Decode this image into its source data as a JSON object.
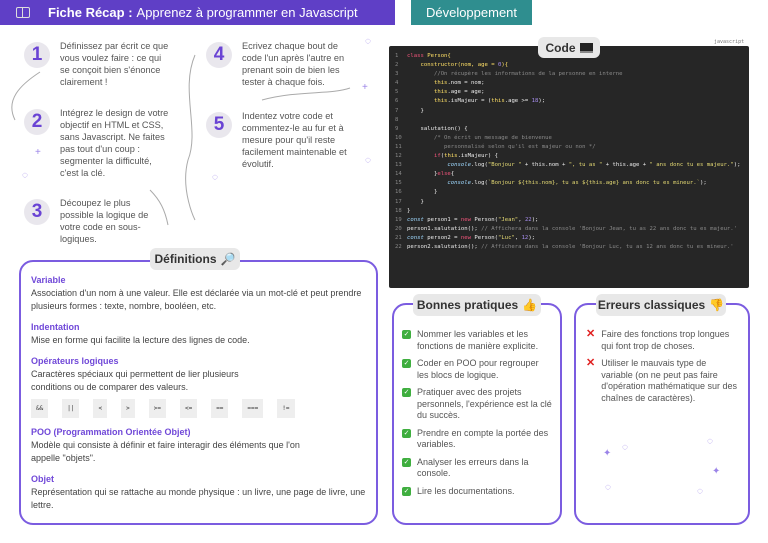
{
  "header": {
    "title_bold": "Fiche Récap :",
    "title": "Apprenez à programmer en Javascript",
    "tag": "Développement",
    "icon": "book-icon"
  },
  "steps": [
    {
      "num": "1",
      "text": "Définissez par écrit ce que vous voulez faire : ce qui se conçoit bien s'énonce clairement !"
    },
    {
      "num": "2",
      "text": "Intégrez le design de votre objectif en HTML et CSS, sans Javascript. Ne faites pas tout d'un coup : segmenter la difficulté, c'est la clé."
    },
    {
      "num": "3",
      "text": "Découpez le plus possible la logique de votre code en sous-logiques."
    },
    {
      "num": "4",
      "text": "Ecrivez chaque bout de code l'un après l'autre en prenant soin de bien les tester à chaque fois."
    },
    {
      "num": "5",
      "text": "Indentez votre code et commentez-le au fur et à mesure pour qu'il reste facilement maintenable et évolutif."
    }
  ],
  "code": {
    "label": "Code",
    "language": "javascript",
    "icon": "laptop-icon",
    "lines": [
      {
        "n": "1",
        "t": [
          [
            "class ",
            "k"
          ],
          [
            "Person{",
            "f"
          ]
        ]
      },
      {
        "n": "2",
        "t": [
          [
            "    constructor(nom, age = ",
            "f"
          ],
          [
            "0",
            "n"
          ],
          [
            "){",
            "f"
          ]
        ]
      },
      {
        "n": "3",
        "t": [
          [
            "        //On récupère les informations de la personne en interne",
            "c"
          ]
        ]
      },
      {
        "n": "4",
        "t": [
          [
            "        this",
            "f"
          ],
          [
            ".nom = nom;",
            ""
          ]
        ]
      },
      {
        "n": "5",
        "t": [
          [
            "        this",
            "f"
          ],
          [
            ".age = age;",
            ""
          ]
        ]
      },
      {
        "n": "6",
        "t": [
          [
            "        this",
            "f"
          ],
          [
            ".isMajeur = (",
            ""
          ],
          [
            "this",
            "f"
          ],
          [
            ".age >= ",
            ""
          ],
          [
            "18",
            "n"
          ],
          [
            ");",
            ""
          ]
        ]
      },
      {
        "n": "7",
        "t": [
          [
            "    }",
            ""
          ]
        ]
      },
      {
        "n": "8",
        "t": [
          [
            "",
            ""
          ]
        ]
      },
      {
        "n": "9",
        "t": [
          [
            "    salutation() {",
            ""
          ]
        ]
      },
      {
        "n": "10",
        "t": [
          [
            "        /* On écrit un message de bienvenue",
            "c"
          ]
        ]
      },
      {
        "n": "11",
        "t": [
          [
            "           personnalisé selon qu'il est majeur ou non */",
            "c"
          ]
        ]
      },
      {
        "n": "12",
        "t": [
          [
            "        if",
            "k"
          ],
          [
            "(",
            ""
          ],
          [
            "this",
            "f"
          ],
          [
            ".isMajeur) {",
            ""
          ]
        ]
      },
      {
        "n": "13",
        "t": [
          [
            "            console",
            "i"
          ],
          [
            ".log(",
            ""
          ],
          [
            "\"Bonjour \"",
            "s"
          ],
          [
            " + this.nom + ",
            ""
          ],
          [
            "\", tu as \"",
            "s"
          ],
          [
            " + this.age + ",
            ""
          ],
          [
            "\" ans donc tu es majeur.\"",
            "s"
          ],
          [
            ");",
            ""
          ]
        ]
      },
      {
        "n": "14",
        "t": [
          [
            "        }",
            ""
          ],
          [
            "else",
            "k"
          ],
          [
            "{",
            ""
          ]
        ]
      },
      {
        "n": "15",
        "t": [
          [
            "            console",
            "i"
          ],
          [
            ".log(",
            ""
          ],
          [
            "`Bonjour ${this.nom}, tu as ${this.age} ans donc tu es mineur.`",
            "s"
          ],
          [
            ");",
            ""
          ]
        ]
      },
      {
        "n": "16",
        "t": [
          [
            "        }",
            ""
          ]
        ]
      },
      {
        "n": "17",
        "t": [
          [
            "    }",
            ""
          ]
        ]
      },
      {
        "n": "18",
        "t": [
          [
            "}",
            ""
          ]
        ]
      },
      {
        "n": "19",
        "t": [
          [
            "const ",
            "i"
          ],
          [
            "person1 = ",
            ""
          ],
          [
            "new ",
            "k"
          ],
          [
            "Person(",
            ""
          ],
          [
            "\"Jean\"",
            "s"
          ],
          [
            ", ",
            ""
          ],
          [
            "22",
            "n"
          ],
          [
            ");",
            ""
          ]
        ]
      },
      {
        "n": "20",
        "t": [
          [
            "person1.salutation(); ",
            ""
          ],
          [
            "// Affichera dans la console 'Bonjour Jean, tu as 22 ans donc tu es majeur.'",
            "c"
          ]
        ]
      },
      {
        "n": "21",
        "t": [
          [
            "const ",
            "i"
          ],
          [
            "person2 = ",
            ""
          ],
          [
            "new ",
            "k"
          ],
          [
            "Person(",
            ""
          ],
          [
            "\"Luc\"",
            "s"
          ],
          [
            ", ",
            ""
          ],
          [
            "12",
            "n"
          ],
          [
            ");",
            ""
          ]
        ]
      },
      {
        "n": "22",
        "t": [
          [
            "person2.salutation(); ",
            ""
          ],
          [
            "// Affichera dans la console 'Bonjour Luc, tu as 12 ans donc tu es mineur.'",
            "c"
          ]
        ]
      }
    ]
  },
  "definitions": {
    "title": "Définitions",
    "icon": "magnifier-icon",
    "items": [
      {
        "term": "Variable",
        "desc": "Association d'un nom à une valeur. Elle est déclarée via un mot-clé et peut prendre plusieurs formes : texte, nombre, booléen, etc."
      },
      {
        "term": "Indentation",
        "desc": "Mise en forme qui facilite la lecture des lignes de code."
      },
      {
        "term": "Opérateurs logiques",
        "desc": "Caractères spéciaux qui permettent de lier plusieurs conditions ou de comparer des valeurs."
      },
      {
        "term": "POO (Programmation Orientée Objet)",
        "desc": "Modèle qui consiste à définir et faire interagir des éléments que l'on appelle \"objets\"."
      },
      {
        "term": "Objet",
        "desc": "Représentation qui se rattache au monde physique : un livre, une page de livre, une lettre."
      }
    ],
    "operators": [
      "&&",
      "||",
      "<",
      ">",
      ">=",
      "<=",
      "==",
      "===",
      "!="
    ]
  },
  "good": {
    "title": "Bonnes pratiques",
    "icon": "thumbs-up-icon",
    "items": [
      "Nommer les variables et les fonctions de manière explicite.",
      "Coder en POO pour regrouper les blocs de logique.",
      "Pratiquer avec des projets personnels, l'expérience est la clé du succès.",
      "Prendre en compte la portée des variables.",
      "Analyser les erreurs dans la console.",
      "Lire les documentations."
    ]
  },
  "bad": {
    "title": "Erreurs classiques",
    "icon": "thumbs-down-icon",
    "items": [
      "Faire des fonctions trop longues qui font trop de choses.",
      "Utiliser le mauvais type de variable (on ne peut pas faire d'opération mathématique sur des chaînes de caractères)."
    ]
  }
}
